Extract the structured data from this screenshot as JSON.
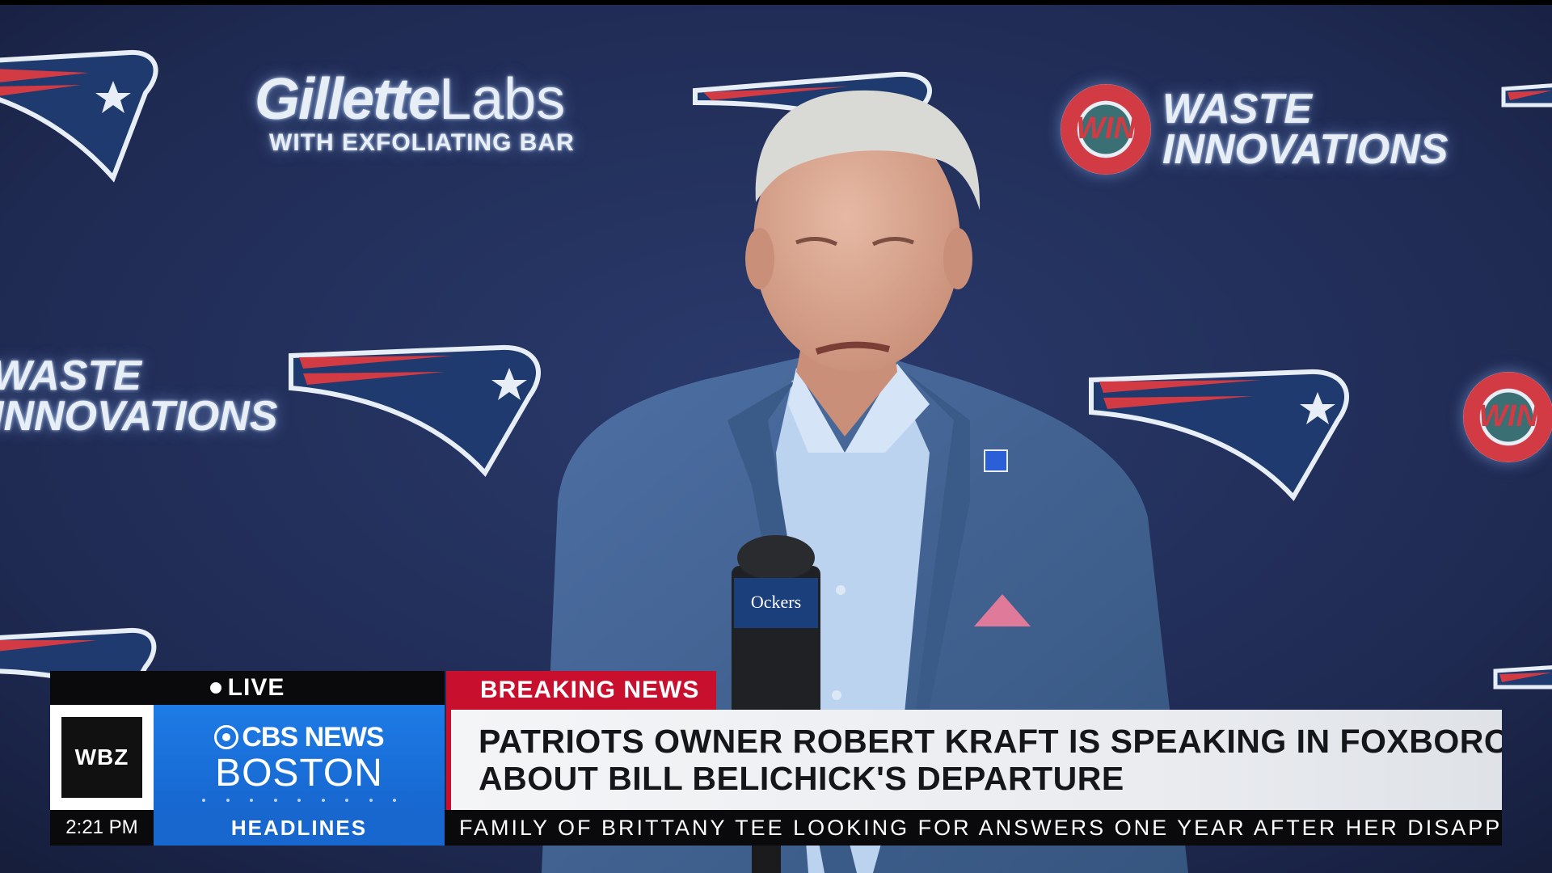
{
  "backdrop": {
    "sponsor_1_brand": "Gillette",
    "sponsor_1_brand_thin": "Labs",
    "sponsor_1_sub": "WITH EXFOLIATING BAR",
    "sponsor_2_badge": "WIN",
    "sponsor_2_line1": "WASTE",
    "sponsor_2_line2": "INNOVATIONS",
    "mic_flag": "Ockers"
  },
  "lower_third": {
    "live_label": "LIVE",
    "breaking_label": "BREAKING NEWS",
    "station_call": "WBZ",
    "network_name": "CBS NEWS",
    "city_name": "BOSTON",
    "headline_line1": "PATRIOTS OWNER ROBERT KRAFT IS SPEAKING IN FOXBORO",
    "headline_line2": "ABOUT BILL BELICHICK'S DEPARTURE"
  },
  "ticker": {
    "time": "2:21 PM",
    "section": "HEADLINES",
    "text": "FAMILY OF BRITTANY TEE LOOKING FOR ANSWERS ONE YEAR AFTER HER DISAPPEARA"
  },
  "colors": {
    "backdrop_navy": "#1f2a52",
    "breaking_red": "#c8102e",
    "cbs_blue": "#1767cf",
    "jacket_blue": "#3f5f8e"
  }
}
